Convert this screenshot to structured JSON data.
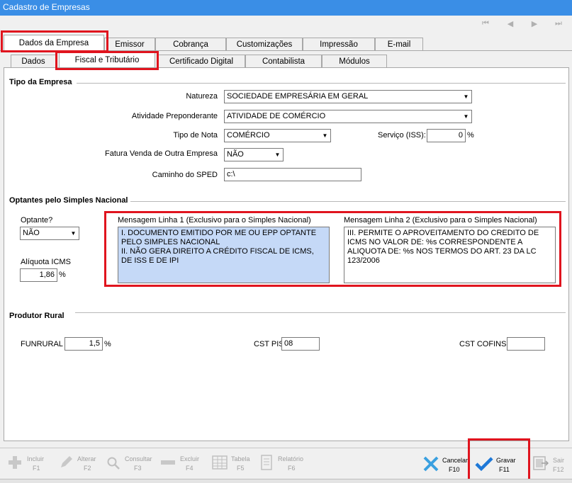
{
  "window": {
    "title": "Cadastro de Empresas"
  },
  "nav_icons": [
    "first-icon",
    "previous-icon",
    "next-icon",
    "last-icon"
  ],
  "tabs_top": [
    "Dados da Empresa",
    "Emissor",
    "Cobrança",
    "Customizações",
    "Impressão",
    "E-mail"
  ],
  "tabs_sub": [
    "Dados",
    "Fiscal e Tributário",
    "Certificado Digital",
    "Contabilista",
    "Módulos"
  ],
  "tipo_empresa": {
    "title": "Tipo da Empresa",
    "natureza_label": "Natureza",
    "natureza_value": "SOCIEDADE EMPRESÁRIA EM GERAL",
    "atividade_label": "Atividade Preponderante",
    "atividade_value": "ATIVIDADE DE COMÉRCIO",
    "tipo_nota_label": "Tipo de Nota",
    "tipo_nota_value": "COMÉRCIO",
    "servico_label": "Serviço (ISS):",
    "servico_value": "0",
    "servico_unit": "%",
    "fatura_label": "Fatura Venda de Outra Empresa",
    "fatura_value": "NÃO",
    "sped_label": "Caminho do SPED",
    "sped_value": "c:\\"
  },
  "simples": {
    "title": "Optantes pelo Simples Nacional",
    "optante_label": "Optante?",
    "optante_value": "NÃO",
    "aliquota_label": "Alíquota ICMS",
    "aliquota_value": "1,86",
    "aliquota_unit": "%",
    "msg1_title": "Mensagem Linha 1 (Exclusivo para  o Simples Nacional)",
    "msg1_text": "I. DOCUMENTO EMITIDO POR ME OU EPP OPTANTE PELO SIMPLES NACIONAL\nII. NÃO GERA DIREITO A CRÉDITO FISCAL DE ICMS, DE ISS E DE IPI",
    "msg2_title": "Mensagem Linha 2 (Exclusivo para o Simples Nacional)",
    "msg2_text": "III. PERMITE O APROVEITAMENTO DO CREDITO DE ICMS NO VALOR DE: %s CORRESPONDENTE A ALIQUOTA DE: %s NOS TERMOS DO ART. 23 DA LC 123/2006"
  },
  "produtor": {
    "title": "Produtor Rural",
    "funrural_label": "FUNRURAL",
    "funrural_value": "1,5",
    "funrural_unit": "%",
    "cst_pis_label": "CST PIS",
    "cst_pis_value": "08",
    "cst_cofins_label": "CST COFINS",
    "cst_cofins_value": ""
  },
  "toolbar": {
    "incluir": {
      "label": "Incluir",
      "key": "F1"
    },
    "alterar": {
      "label": "Alterar",
      "key": "F2"
    },
    "consultar": {
      "label": "Consultar",
      "key": "F3"
    },
    "excluir": {
      "label": "Excluir",
      "key": "F4"
    },
    "tabela": {
      "label": "Tabela",
      "key": "F5"
    },
    "relatorio": {
      "label": "Relatório",
      "key": "F6"
    },
    "cancelar": {
      "label": "Cancelar",
      "key": "F10"
    },
    "gravar": {
      "label": "Gravar",
      "key": "F11"
    },
    "sair": {
      "label": "Sair",
      "key": "F12"
    }
  },
  "colors": {
    "titlebar": "#3a8ee6",
    "highlight_box": "#e0141e",
    "memo_selected": "#c5d9f7",
    "check": "#1e78d7",
    "cancel_x": "#3aa0e0"
  }
}
